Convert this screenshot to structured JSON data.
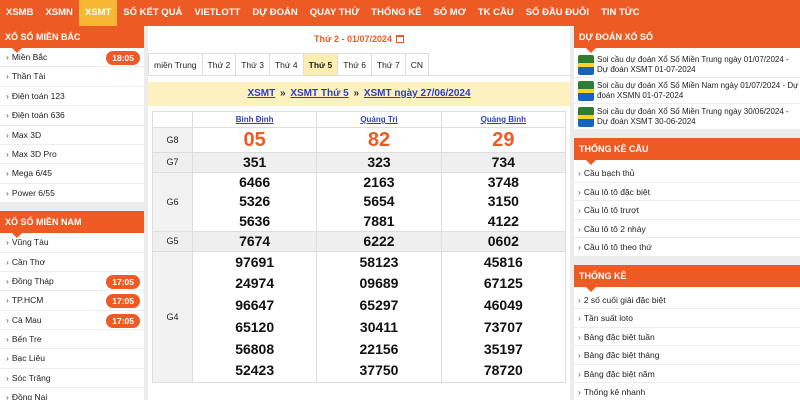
{
  "nav": [
    {
      "label": "XSMB",
      "active": false
    },
    {
      "label": "XSMN",
      "active": false
    },
    {
      "label": "XSMT",
      "active": true
    },
    {
      "label": "SỐ KẾT QUẢ",
      "active": false
    },
    {
      "label": "VIETLOTT",
      "active": false
    },
    {
      "label": "DỰ ĐOÁN",
      "active": false
    },
    {
      "label": "QUAY THỬ",
      "active": false
    },
    {
      "label": "THỐNG KÊ",
      "active": false
    },
    {
      "label": "SỔ MƠ",
      "active": false
    },
    {
      "label": "TK CẦU",
      "active": false
    },
    {
      "label": "SỐ ĐẦU ĐUÔI",
      "active": false
    },
    {
      "label": "TIN TỨC",
      "active": false
    }
  ],
  "left": {
    "north_title": "XỔ SỐ MIỀN BẮC",
    "north_items": [
      {
        "label": "Miền Bắc",
        "time": "18:05"
      },
      {
        "label": "Thần Tài",
        "time": ""
      },
      {
        "label": "Điện toán 123",
        "time": ""
      },
      {
        "label": "Điện toán 636",
        "time": ""
      },
      {
        "label": "Max 3D",
        "time": ""
      },
      {
        "label": "Max 3D Pro",
        "time": ""
      },
      {
        "label": "Mega 6/45",
        "time": ""
      },
      {
        "label": "Power 6/55",
        "time": ""
      }
    ],
    "south_title": "XỔ SỐ MIỀN NAM",
    "south_items": [
      {
        "label": "Vũng Tàu",
        "time": ""
      },
      {
        "label": "Cần Thơ",
        "time": ""
      },
      {
        "label": "Đồng Tháp",
        "time": "17:05"
      },
      {
        "label": "TP.HCM",
        "time": "17:05"
      },
      {
        "label": "Cà Mau",
        "time": "17:05"
      },
      {
        "label": "Bến Tre",
        "time": ""
      },
      {
        "label": "Bạc Liêu",
        "time": ""
      },
      {
        "label": "Sóc Trăng",
        "time": ""
      },
      {
        "label": "Đồng Nai",
        "time": ""
      }
    ]
  },
  "main": {
    "date_label": "Thứ 2 -  01/07/2024",
    "tabs": [
      {
        "label": "miền Trung",
        "active": false
      },
      {
        "label": "Thứ 2",
        "active": false
      },
      {
        "label": "Thứ 3",
        "active": false
      },
      {
        "label": "Thứ 4",
        "active": false
      },
      {
        "label": "Thứ 5",
        "active": true
      },
      {
        "label": "Thứ 6",
        "active": false
      },
      {
        "label": "Thứ 7",
        "active": false
      },
      {
        "label": "CN",
        "active": false
      }
    ],
    "breadcrumb": {
      "a": "XSMT",
      "b": "XSMT Thứ 5",
      "c": "XSMT ngày 27/06/2024",
      "sep": "»"
    },
    "provinces": [
      "Bình Định",
      "Quảng Trị",
      "Quảng Bình"
    ],
    "prizes": {
      "G8": [
        "05",
        "82",
        "29"
      ],
      "G7": [
        "351",
        "323",
        "734"
      ],
      "G6": [
        [
          "6466",
          "5326",
          "5636"
        ],
        [
          "2163",
          "5654",
          "7881"
        ],
        [
          "3748",
          "3150",
          "4122"
        ]
      ],
      "G5": [
        "7674",
        "6222",
        "0602"
      ],
      "G4": [
        [
          "97691",
          "24974",
          "96647",
          "65120",
          "56808",
          "52423"
        ],
        [
          "58123",
          "09689",
          "65297",
          "30411",
          "22156",
          "37750"
        ],
        [
          "45816",
          "67125",
          "46049",
          "73707",
          "35197",
          "78720"
        ]
      ]
    },
    "prize_labels": {
      "g8": "G8",
      "g7": "G7",
      "g6": "G6",
      "g5": "G5",
      "g4": "G4"
    }
  },
  "right": {
    "pred_title": "DỰ ĐOÁN XỔ SỐ",
    "predictions": [
      "Soi cầu dự đoán Xổ Số Miền Trung ngày 01/07/2024 - Dự đoán XSMT 01-07-2024",
      "Soi cầu dự đoán Xổ Số Miền Nam ngày 01/07/2024 - Dự đoán XSMN 01-07-2024",
      "Soi cầu dự đoán Xổ Số Miền Trung ngày 30/06/2024 - Dự đoán XSMT 30-06-2024"
    ],
    "cau_title": "THỐNG KÊ CẦU",
    "cau_items": [
      "Cầu bạch thủ",
      "Cầu lô tô đặc biệt",
      "Cầu lô tô trượt",
      "Cầu lô tô 2 nháy",
      "Cầu lô tô theo thứ"
    ],
    "tk_title": "THỐNG KÊ",
    "tk_items": [
      "2 số cuối giải đặc biệt",
      "Tần suất loto",
      "Bảng đặc biệt tuần",
      "Bảng đặc biệt tháng",
      "Bảng đặc biệt năm",
      "Thống kê nhanh"
    ]
  },
  "colors": {
    "brand": "#ee5a24",
    "active_nav": "#f7b733",
    "link_blue": "#2d3ec4",
    "banner_bg": "#fdf1c0"
  }
}
